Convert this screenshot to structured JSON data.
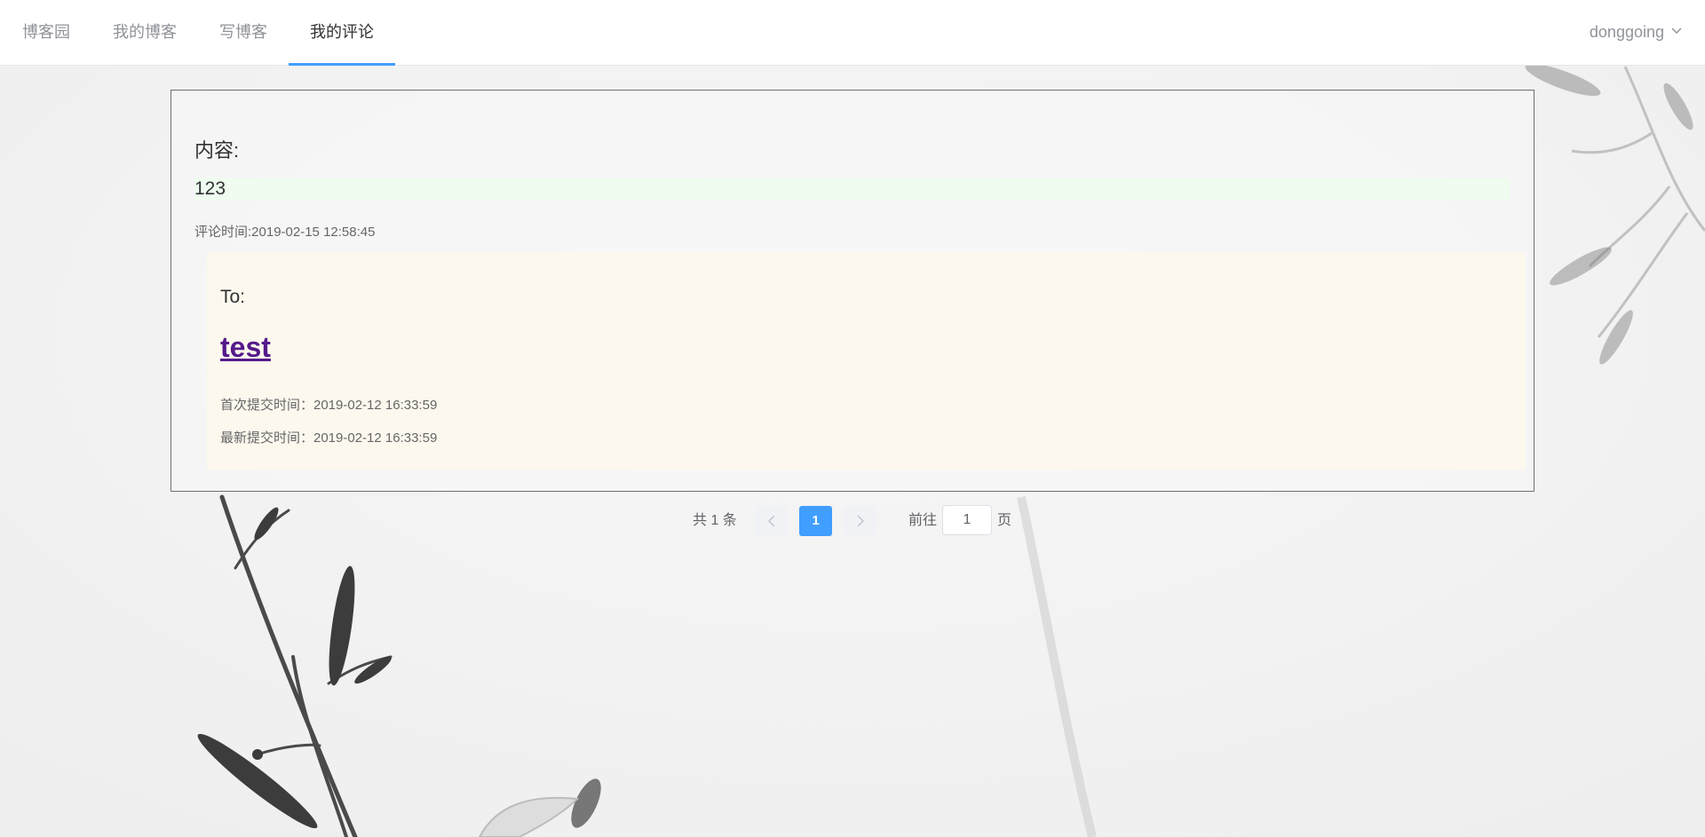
{
  "nav": {
    "items": [
      {
        "label": "博客园"
      },
      {
        "label": "我的博客"
      },
      {
        "label": "写博客"
      },
      {
        "label": "我的评论",
        "active": true
      }
    ],
    "user": "donggoing",
    "accent_color": "#409eff"
  },
  "comment": {
    "content_label": "内容:",
    "content_value": "123",
    "comment_time": "评论时间:2019-02-15 12:58:45",
    "target": {
      "to_label": "To:",
      "blog_title": "test",
      "first_submit": "首次提交时间：2019-02-12 16:33:59",
      "latest_submit": "最新提交时间：2019-02-12 16:33:59"
    }
  },
  "pagination": {
    "total": "共 1 条",
    "current_page": "1",
    "goto_label": "前往",
    "goto_value": "1",
    "page_unit": "页"
  },
  "icons": {
    "user_menu": "chevron-down-icon",
    "prev": "chevron-left-icon",
    "next": "chevron-right-icon"
  }
}
